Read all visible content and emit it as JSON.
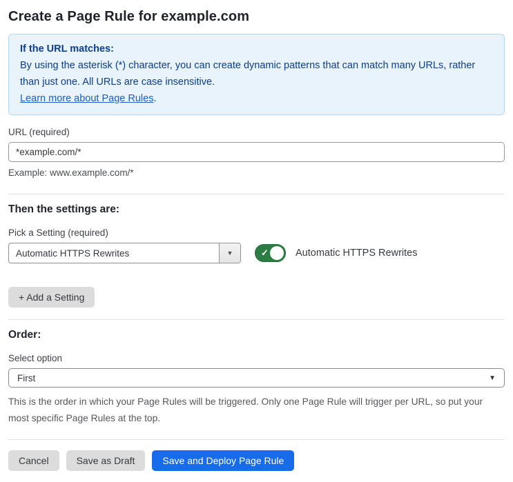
{
  "page": {
    "title": "Create a Page Rule for example.com"
  },
  "info_box": {
    "heading": "If the URL matches:",
    "body": "By using the asterisk (*) character, you can create dynamic patterns that can match many URLs, rather than just one. All URLs are case insensitive.",
    "link_label": "Learn more about Page Rules",
    "link_suffix": "."
  },
  "url_field": {
    "label": "URL (required)",
    "value": "*example.com/*",
    "hint": "Example: www.example.com/*"
  },
  "settings_section": {
    "heading": "Then the settings are:",
    "picker_label": "Pick a Setting (required)",
    "picker_value": "Automatic HTTPS Rewrites",
    "toggle_label": "Automatic HTTPS Rewrites",
    "toggle_state": "on",
    "add_setting_label": "+ Add a Setting"
  },
  "order_section": {
    "heading": "Order:",
    "select_label": "Select option",
    "select_value": "First",
    "description": "This is the order in which your Page Rules will be triggered. Only one Page Rule will trigger per URL, so put your most specific Page Rules at the top."
  },
  "footer": {
    "cancel_label": "Cancel",
    "save_draft_label": "Save as Draft",
    "save_deploy_label": "Save and Deploy Page Rule"
  },
  "icons": {
    "dropdown_arrow": "▼",
    "checkmark": "✓"
  },
  "colors": {
    "accent_blue": "#186ce9",
    "toggle_green": "#2c7d43",
    "info_bg": "#e9f3fc",
    "info_border": "#b3d7f2",
    "info_text": "#0d3d8f",
    "link_blue": "#1c5dc9",
    "button_gray": "#dcdcdc"
  }
}
